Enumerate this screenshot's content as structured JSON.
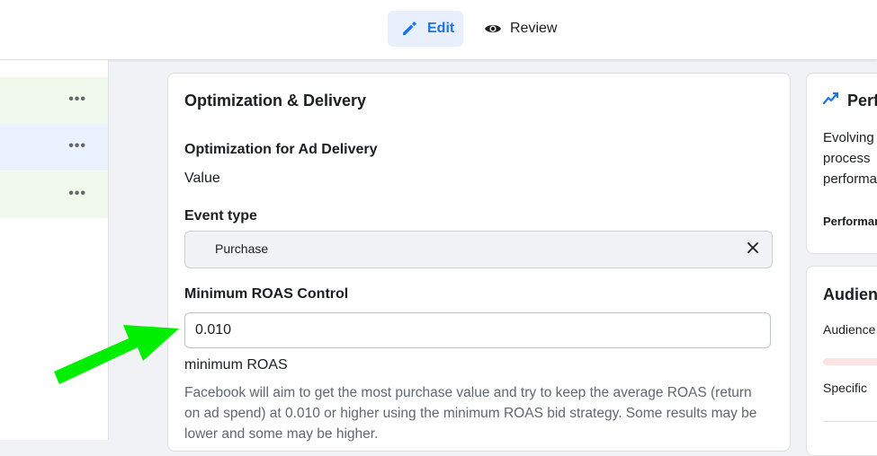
{
  "tabs": {
    "edit_label": "Edit",
    "review_label": "Review"
  },
  "sidebar": {
    "rows": [
      {
        "more": "•••"
      },
      {
        "more": "•••"
      },
      {
        "more": "•••"
      }
    ]
  },
  "card": {
    "title": "Optimization & Delivery",
    "optimization_label": "Optimization for Ad Delivery",
    "optimization_value": "Value",
    "event_type_label": "Event type",
    "event_type_value": "Purchase",
    "roas_label": "Minimum ROAS Control",
    "roas_value": "0.010",
    "roas_unit": "minimum ROAS",
    "roas_help": "Facebook will aim to get the most purchase value and try to keep the average ROAS (return on ad spend) at 0.010 or higher using the minimum ROAS bid strategy. Some results may be lower and some may be higher."
  },
  "right_panel": {
    "perf_title": "Perf",
    "perf_text_1": "Evolving",
    "perf_text_2": "process",
    "perf_text_3": "performa",
    "perf_small": "Performar",
    "audience_title": "Audienc",
    "audience_label": "Audience",
    "specific_label": "Specific"
  },
  "colors": {
    "accent": "#1b74e4",
    "arrow": "#00ee00",
    "success_row": "#f1f8ec",
    "info_row": "#eaf3fd"
  }
}
